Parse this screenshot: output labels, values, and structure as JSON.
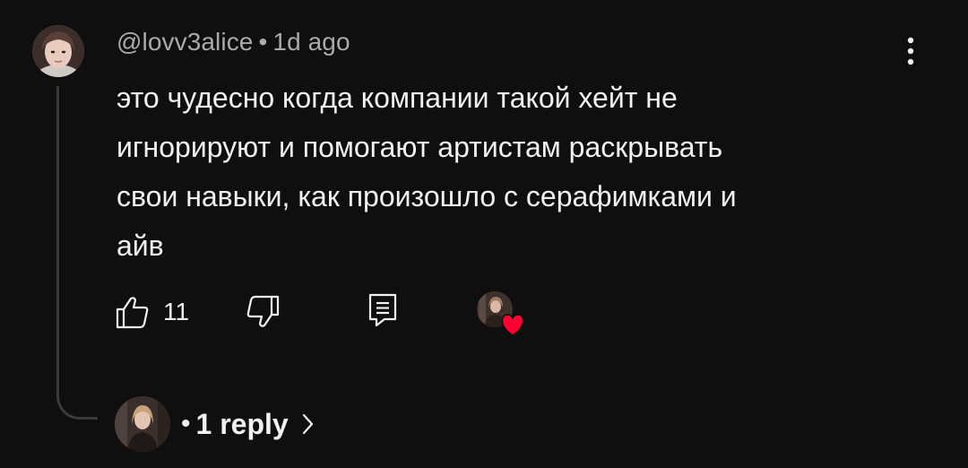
{
  "comment": {
    "author": "@lovv3alice",
    "separator": "•",
    "time": "1d ago",
    "text": "это чудесно когда компании такой хейт не\nигнорируют и помогают артистам раскрывать\nсвои навыки, как произошло с серафимками и\nайв",
    "like_count": "11"
  },
  "replies": {
    "separator": "•",
    "label": "1 reply"
  },
  "icons": {
    "more": "more-vert-icon",
    "like": "thumb-up-icon",
    "dislike": "thumb-down-icon",
    "reply": "comment-reply-icon",
    "heart": "heart-icon",
    "chevron": "chevron-right-icon"
  },
  "colors": {
    "background": "#0f0f0f",
    "text": "#f1f1f1",
    "meta_text": "#aaaaaa",
    "heart": "#ff0033",
    "thread_line": "#3a3a3a"
  }
}
